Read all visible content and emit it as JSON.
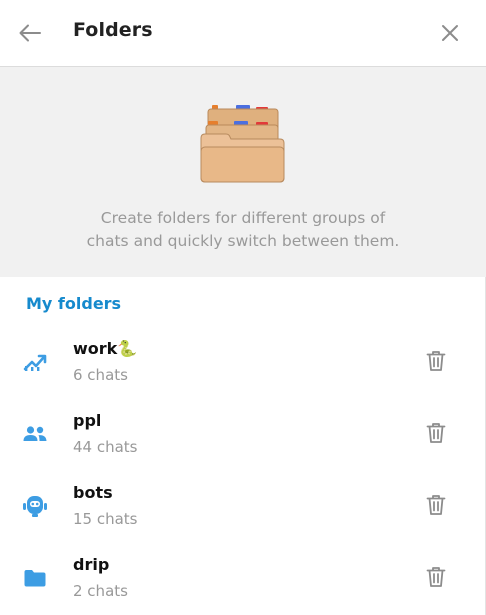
{
  "header": {
    "title": "Folders",
    "back_icon": "arrow-left-icon",
    "close_icon": "close-icon"
  },
  "hero": {
    "illustration": "folders-illustration",
    "description_line1": "Create folders for different groups of",
    "description_line2": "chats and quickly switch between them."
  },
  "section": {
    "title": "My folders"
  },
  "folders": [
    {
      "name": "work🐍",
      "count": "6 chats",
      "icon": "trending-chart-icon"
    },
    {
      "name": "ppl",
      "count": "44 chats",
      "icon": "people-icon"
    },
    {
      "name": "bots",
      "count": "15 chats",
      "icon": "bot-icon"
    },
    {
      "name": "drip",
      "count": "2 chats",
      "icon": "folder-icon"
    }
  ],
  "colors": {
    "accent": "#168acd",
    "icon_blue": "#3d9de3",
    "muted_text": "#999999",
    "hero_bg": "#f1f1f1"
  }
}
